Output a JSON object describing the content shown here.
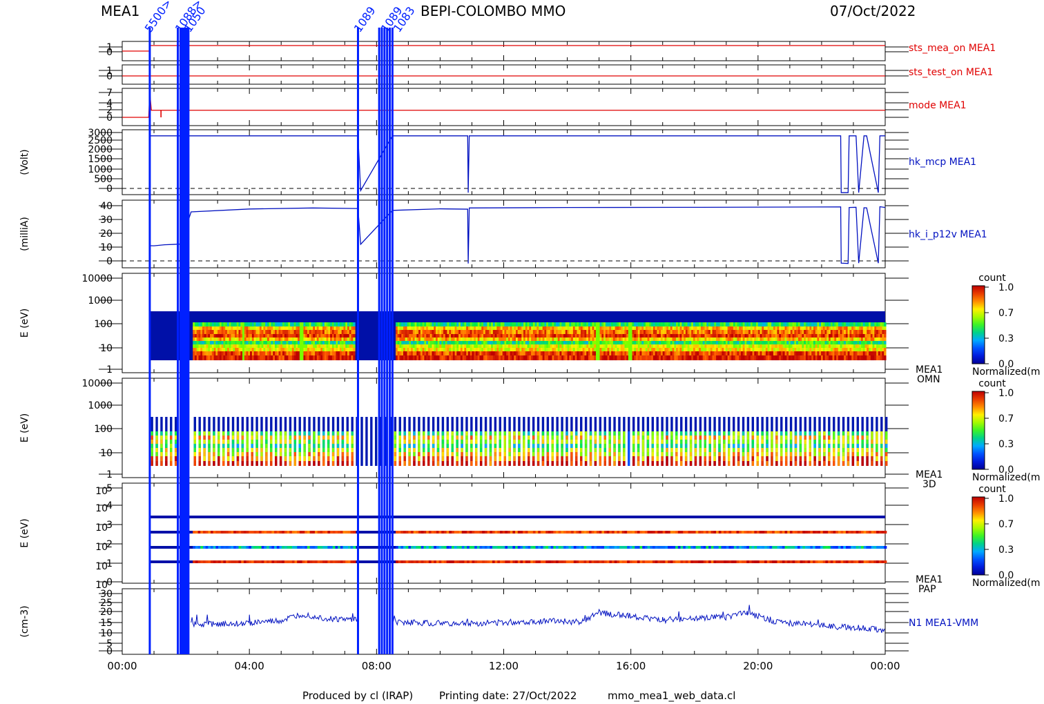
{
  "header": {
    "instrument": "MEA1",
    "mission": "BEPI-COLOMBO MMO",
    "date": "07/Oct/2022"
  },
  "footer": {
    "produced": "Produced by cl (IRAP)",
    "printing": "Printing date: 27/Oct/2022",
    "script": "mmo_mea1_web_data.cl"
  },
  "colors": {
    "status_red": "#e00000",
    "hk_blue": "#0010c0",
    "marker_blue": "#0020ff",
    "background": "#ffffff"
  },
  "chart_data": [
    {
      "type": "line",
      "label": "sts_mea_on MEA1",
      "yticks": [
        "1",
        "0"
      ],
      "series": [
        {
          "name": "sts_mea_on MEA1",
          "x": [
            "00:52",
            "24:00"
          ],
          "values": [
            1,
            1
          ]
        }
      ]
    },
    {
      "type": "line",
      "label": "sts_test_on MEA1",
      "yticks": [
        "1",
        "0"
      ],
      "series": [
        {
          "name": "sts_test_on MEA1",
          "x": [
            "00:00",
            "24:00"
          ],
          "values": [
            0,
            0
          ]
        }
      ]
    },
    {
      "type": "line",
      "label": "mode MEA1",
      "yticks": [
        "7",
        "4",
        "2",
        "0"
      ],
      "series": [
        {
          "name": "mode MEA1",
          "x": [
            "00:00",
            "00:50",
            "00:52",
            "00:55",
            "24:00"
          ],
          "values": [
            0,
            0,
            7,
            2,
            2
          ]
        }
      ]
    },
    {
      "type": "line",
      "label": "hk_mcp MEA1",
      "ylabel": "(Volt)",
      "yticks": [
        "3000",
        "2500",
        "2000",
        "1500",
        "1000",
        "500",
        "0"
      ],
      "ylim": [
        -100,
        3100
      ],
      "series": [
        {
          "name": "hk_mcp MEA1",
          "x": [
            "00:52",
            "07:25",
            "07:30",
            "08:30",
            "10:52",
            "10:53",
            "10:55",
            "22:36",
            "22:37",
            "22:50",
            "22:52",
            "23:05",
            "23:10",
            "23:20",
            "23:25",
            "23:47",
            "23:50",
            "24:00"
          ],
          "values": [
            2800,
            2800,
            100,
            2800,
            2800,
            0,
            2800,
            2800,
            0,
            0,
            2800,
            2800,
            0,
            2800,
            2800,
            0,
            2800,
            2800
          ]
        }
      ]
    },
    {
      "type": "line",
      "label": "hk_i_p12v MEA1",
      "ylabel": "(milliA)",
      "yticks": [
        "40",
        "30",
        "20",
        "10",
        "0"
      ],
      "ylim": [
        -3,
        43
      ],
      "series": [
        {
          "name": "hk_i_p12v MEA1",
          "x": [
            "00:52",
            "01:00",
            "01:20",
            "01:50",
            "02:10",
            "04:00",
            "06:00",
            "07:25",
            "07:30",
            "08:30",
            "10:00",
            "10:52",
            "10:53",
            "10:55",
            "14:00",
            "18:00",
            "22:36",
            "22:37",
            "22:50",
            "22:52",
            "23:05",
            "23:10",
            "23:20",
            "23:25",
            "23:47",
            "23:50",
            "24:00"
          ],
          "values": [
            12,
            12,
            12.5,
            13,
            35,
            37,
            37.5,
            37.5,
            13,
            36,
            37,
            37,
            0,
            37.5,
            38,
            38,
            38.5,
            0,
            0,
            38,
            38,
            0,
            38,
            38,
            0,
            38.5,
            38
          ]
        }
      ]
    },
    {
      "type": "heatmap",
      "label": "MEA1 OMN",
      "ylabel": "E (eV)",
      "yticks": [
        "10000",
        "1000",
        "100",
        "10",
        "1"
      ],
      "colorbar": {
        "title": "count",
        "ticks": [
          "1.0",
          "0.7",
          "0.3",
          "0.0"
        ],
        "label": "Normalized(m"
      }
    },
    {
      "type": "heatmap",
      "label": "MEA1 3D",
      "ylabel": "E (eV)",
      "yticks": [
        "10000",
        "1000",
        "100",
        "10",
        "1"
      ],
      "colorbar": {
        "title": "count",
        "ticks": [
          "1.0",
          "0.7",
          "0.3",
          "0.0"
        ],
        "label": "Normalized(m"
      }
    },
    {
      "type": "heatmap",
      "label": "MEA1 PAP",
      "ylabel": "E (eV)",
      "yticks": [
        "5",
        "4",
        "3",
        "2",
        "1",
        "0"
      ],
      "colorbar": {
        "title": "count",
        "ticks": [
          "1.0",
          "0.7",
          "0.3",
          "0.0"
        ],
        "label": "Normalized(m"
      }
    },
    {
      "type": "line",
      "label": "N1 MEA1-VMM",
      "ylabel": "(cm-3)",
      "yticks": [
        "30",
        "25",
        "20",
        "15",
        "10",
        "5",
        "0"
      ],
      "ylim": [
        0,
        31
      ],
      "series": [
        {
          "name": "N1 MEA1-VMM",
          "x": [
            "02:10",
            "03:00",
            "04:00",
            "05:00",
            "05:40",
            "06:30",
            "07:25",
            "08:30",
            "09:30",
            "10:30",
            "11:30",
            "12:30",
            "13:30",
            "14:30",
            "15:00",
            "16:00",
            "17:00",
            "18:00",
            "19:00",
            "19:40",
            "20:30",
            "21:30",
            "22:30",
            "23:30",
            "24:00"
          ],
          "values": [
            15.5,
            16,
            16.5,
            17.5,
            21,
            18.5,
            18,
            17,
            16.5,
            16,
            16.5,
            17,
            17.5,
            17,
            22,
            20,
            18,
            19,
            19.5,
            22,
            17,
            16,
            14.5,
            13.5,
            12.5
          ]
        }
      ]
    }
  ],
  "time_axis": {
    "ticks": [
      "00:00",
      "04:00",
      "08:00",
      "12:00",
      "16:00",
      "20:00",
      "00:00"
    ],
    "range_hours": [
      0,
      24
    ]
  },
  "markers": {
    "event_times": [
      "00:52",
      "01:45",
      "01:50",
      "01:52",
      "01:55",
      "01:58",
      "02:00",
      "02:03",
      "02:05",
      "07:25",
      "08:05",
      "08:10",
      "08:15",
      "08:20",
      "08:25",
      "08:30"
    ],
    "labels": [
      "5500>",
      "1089",
      "1088>",
      "1050",
      "1089",
      "1083"
    ]
  }
}
